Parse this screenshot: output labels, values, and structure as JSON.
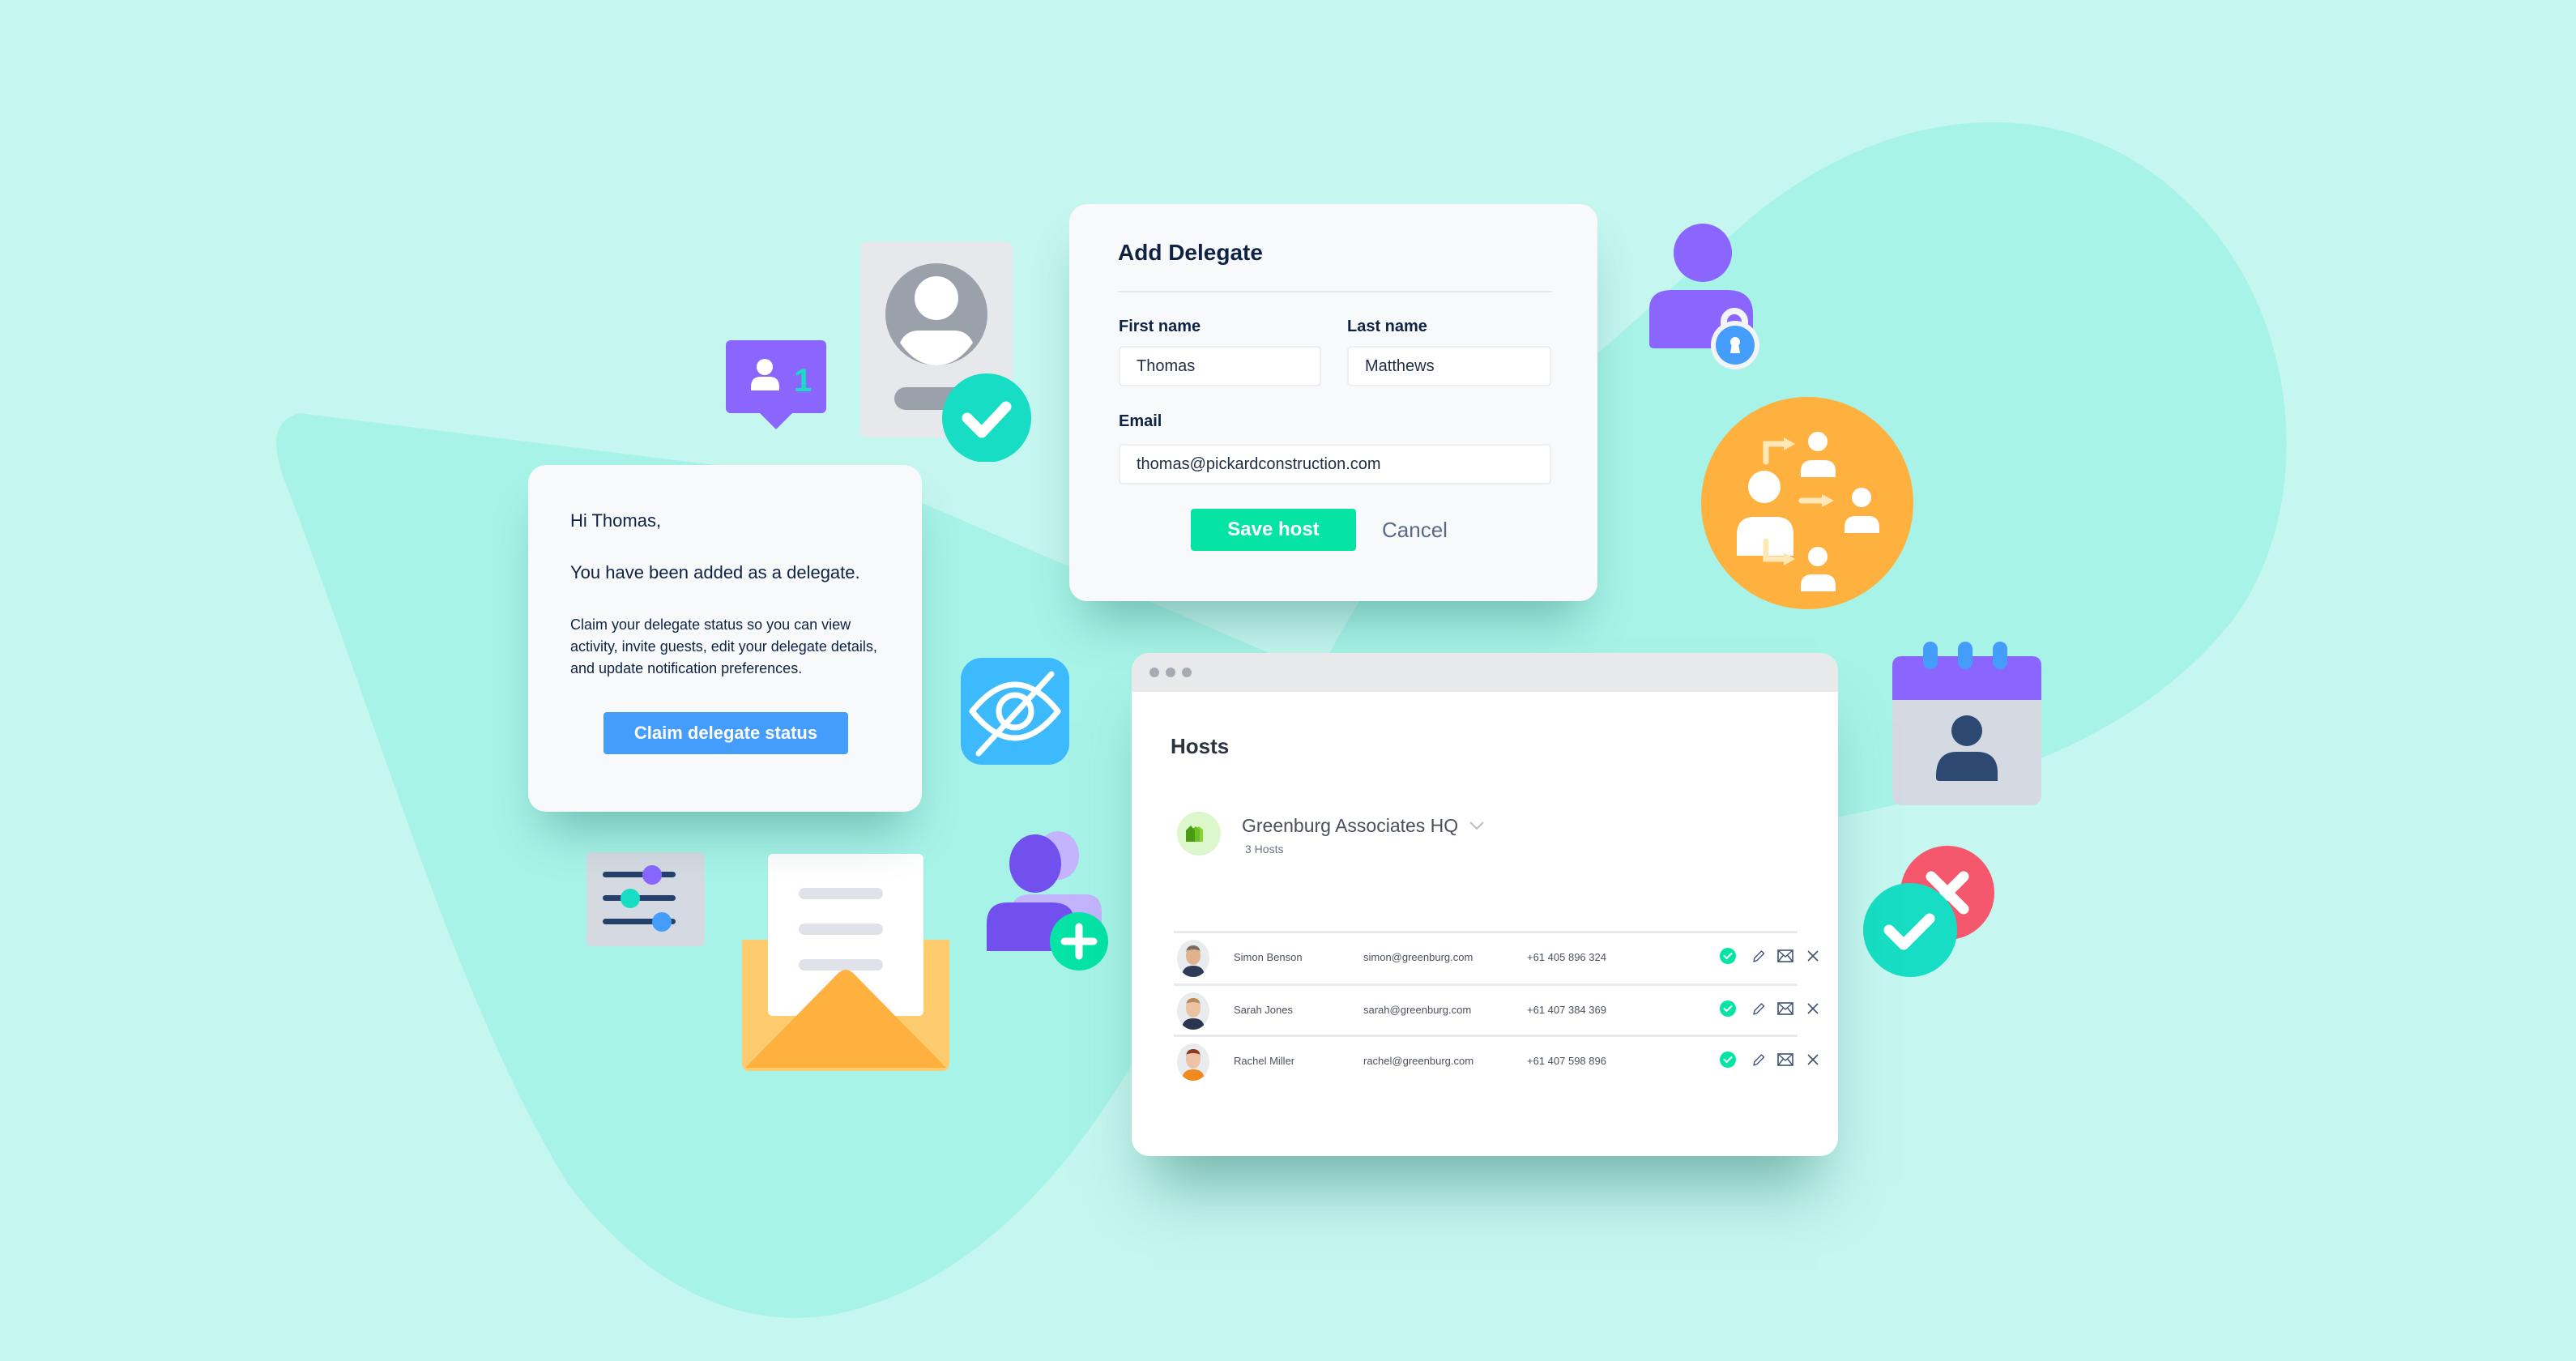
{
  "add_delegate": {
    "title": "Add Delegate",
    "first_name_label": "First name",
    "first_name_value": "Thomas",
    "last_name_label": "Last name",
    "last_name_value": "Matthews",
    "email_label": "Email",
    "email_value": "thomas@pickardconstruction.com",
    "save_label": "Save host",
    "cancel_label": "Cancel"
  },
  "email_card": {
    "greeting": "Hi Thomas,",
    "headline": "You have been added as a delegate.",
    "body": "Claim your delegate status so you can view activity, invite guests, edit your delegate details, and update notification preferences.",
    "button_label": "Claim delegate status"
  },
  "hosts": {
    "title": "Hosts",
    "organization": {
      "name": "Greenburg Associates HQ",
      "count": "3 Hosts"
    },
    "rows": [
      {
        "name": "Simon Benson",
        "email": "simon@greenburg.com",
        "phone": "+61 405 896 324",
        "status": "confirmed"
      },
      {
        "name": "Sarah Jones",
        "email": "sarah@greenburg.com",
        "phone": "+61 407 384 369",
        "status": "confirmed"
      },
      {
        "name": "Rachel Miller",
        "email": "rachel@greenburg.com",
        "phone": "+61 407 598 896",
        "status": "confirmed"
      }
    ]
  },
  "notification_badge": {
    "count": "1"
  },
  "icons": [
    "notification-user-icon",
    "profile-card-icon",
    "check-badge-icon",
    "eye-off-icon",
    "sliders-icon",
    "envelope-letter-icon",
    "add-user-icon",
    "user-lock-icon",
    "delegate-share-icon",
    "calendar-user-icon",
    "approve-reject-icon"
  ],
  "colors": {
    "background": "#C5F6EF",
    "blob": "#A8F3E8",
    "save_button": "#05E3A5",
    "claim_button": "#449CFB",
    "purple": "#8A66FF",
    "orange": "#FFB13F",
    "teal": "#16DDC3",
    "red": "#F5586C"
  }
}
